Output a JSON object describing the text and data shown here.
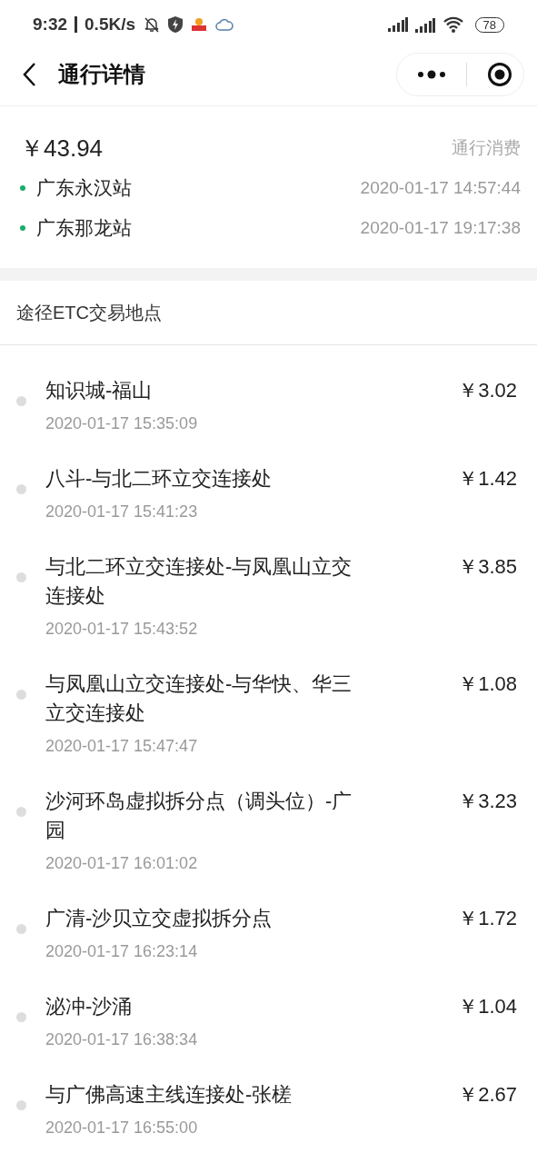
{
  "status_bar": {
    "time": "9:32",
    "network_speed": "0.5K/s",
    "battery": "78"
  },
  "nav": {
    "title": "通行详情"
  },
  "summary": {
    "amount": "￥43.94",
    "label": "通行消费",
    "stations": [
      {
        "name": "广东永汉站",
        "time": "2020-01-17 14:57:44"
      },
      {
        "name": "广东那龙站",
        "time": "2020-01-17 19:17:38"
      }
    ]
  },
  "section_title": "途径ETC交易地点",
  "transactions": [
    {
      "name": "知识城-福山",
      "time": "2020-01-17 15:35:09",
      "amount": "￥3.02"
    },
    {
      "name": "八斗-与北二环立交连接处",
      "time": "2020-01-17 15:41:23",
      "amount": "￥1.42"
    },
    {
      "name": "与北二环立交连接处-与凤凰山立交连接处",
      "time": "2020-01-17 15:43:52",
      "amount": "￥3.85"
    },
    {
      "name": "与凤凰山立交连接处-与华快、华三立交连接处",
      "time": "2020-01-17 15:47:47",
      "amount": "￥1.08"
    },
    {
      "name": "沙河环岛虚拟拆分点（调头位）-广园",
      "time": "2020-01-17 16:01:02",
      "amount": "￥3.23"
    },
    {
      "name": "广清-沙贝立交虚拟拆分点",
      "time": "2020-01-17 16:23:14",
      "amount": "￥1.72"
    },
    {
      "name": "泌冲-沙涌",
      "time": "2020-01-17 16:38:34",
      "amount": "￥1.04"
    },
    {
      "name": "与广佛高速主线连接处-张槎",
      "time": "2020-01-17 16:55:00",
      "amount": "￥2.67"
    }
  ]
}
